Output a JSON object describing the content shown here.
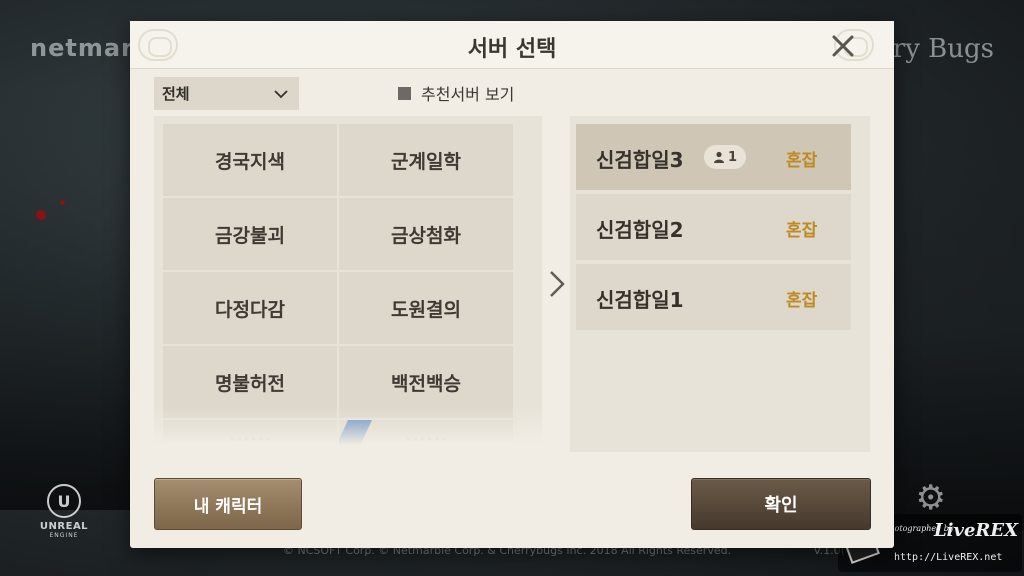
{
  "background": {
    "brand_left": "netmar",
    "brand_right": "ry Bugs",
    "engine_logo_line1": "UNREAL",
    "engine_logo_line2": "ENGINE",
    "copyright": "© NCSOFT Corp. © Netmarble Corp. & Cherrybugs Inc. 2018 All Rights Reserved.",
    "version": "v.1.0(",
    "watermark_photographed": "Photographed by",
    "watermark_name": "LiveREX",
    "watermark_url": "http://LiveREX.net"
  },
  "dialog": {
    "title": "서버 선택",
    "close_icon": "close-icon"
  },
  "filter": {
    "selected": "전체",
    "recommend_label": "추천서버 보기",
    "recommend_checked": false
  },
  "server_groups": [
    {
      "label": "경국지색"
    },
    {
      "label": "군계일학"
    },
    {
      "label": "금강불괴"
    },
    {
      "label": "금상첨화"
    },
    {
      "label": "다정다감"
    },
    {
      "label": "도원결의"
    },
    {
      "label": "명불허전"
    },
    {
      "label": "백전백승"
    },
    {
      "label": "......"
    },
    {
      "label": "......"
    }
  ],
  "servers": [
    {
      "name": "신검합일3",
      "characters": "1",
      "status": "혼잡",
      "selected": true
    },
    {
      "name": "신검합일2",
      "characters": "",
      "status": "혼잡",
      "selected": false
    },
    {
      "name": "신검합일1",
      "characters": "",
      "status": "혼잡",
      "selected": false
    }
  ],
  "buttons": {
    "my_character": "내 캐릭터",
    "confirm": "확인"
  },
  "colors": {
    "status_busy": "#bf8a24",
    "dialog_bg": "#f1ede4",
    "confirm_bg": "#46392c",
    "my_character_bg": "#7d6649"
  }
}
